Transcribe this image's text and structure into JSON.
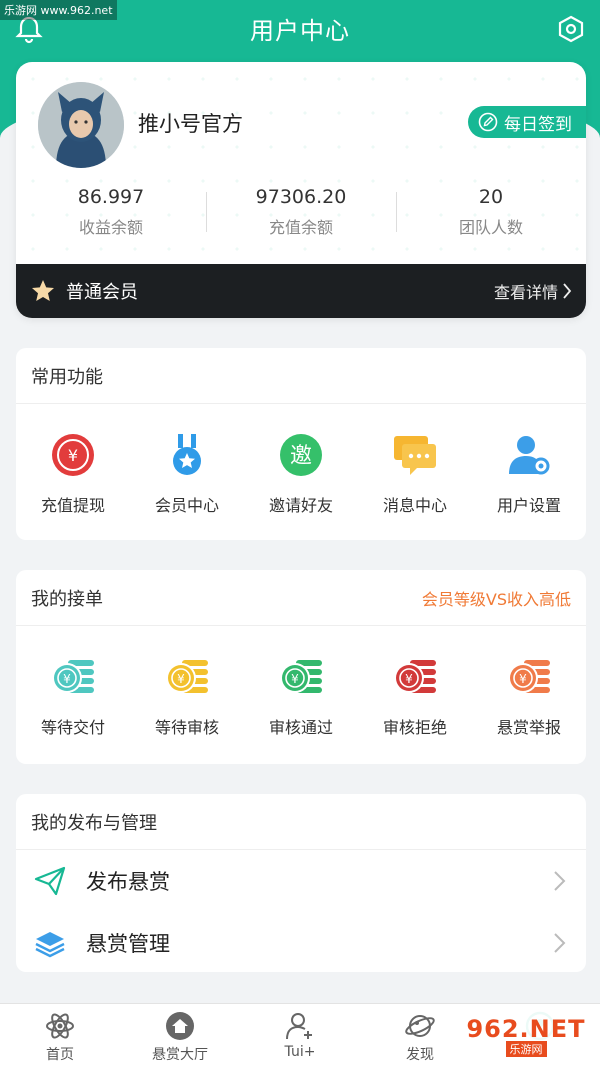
{
  "watermark": "乐游网 www.962.net",
  "header": {
    "title": "用户中心",
    "bell_icon": "bell-icon",
    "settings_icon": "hexagon-gear-icon",
    "accent": "#17b894"
  },
  "profile": {
    "username": "推小号官方",
    "checkin_label": "每日签到",
    "stats": [
      {
        "value": "86.997",
        "label": "收益余额"
      },
      {
        "value": "97306.20",
        "label": "充值余额"
      },
      {
        "value": "20",
        "label": "团队人数"
      }
    ],
    "member_level": "普通会员",
    "member_more": "查看详情"
  },
  "common": {
    "title": "常用功能",
    "items": [
      {
        "label": "充值提现",
        "icon": "yuan-circle-icon",
        "color": "#e23c3c"
      },
      {
        "label": "会员中心",
        "icon": "medal-icon",
        "color": "#2f9be8"
      },
      {
        "label": "邀请好友",
        "icon": "invite-icon",
        "color": "#35c06a",
        "glyph": "邀"
      },
      {
        "label": "消息中心",
        "icon": "chat-bubbles-icon",
        "color": "#f6b631"
      },
      {
        "label": "用户设置",
        "icon": "user-gear-icon",
        "color": "#3c9ee8"
      }
    ]
  },
  "orders": {
    "title": "我的接单",
    "extra": "会员等级VS收入高低",
    "items": [
      {
        "label": "等待交付",
        "icon": "coins-icon",
        "color": "#4fc7c0"
      },
      {
        "label": "等待审核",
        "icon": "coins-icon",
        "color": "#f3c12e"
      },
      {
        "label": "审核通过",
        "icon": "coins-icon",
        "color": "#33b86d"
      },
      {
        "label": "审核拒绝",
        "icon": "coins-icon",
        "color": "#d23a3a"
      },
      {
        "label": "悬赏举报",
        "icon": "coins-icon",
        "color": "#f07b4a"
      }
    ]
  },
  "publish": {
    "title": "我的发布与管理",
    "rows": [
      {
        "label": "发布悬赏",
        "icon": "paper-plane-icon"
      },
      {
        "label": "悬赏管理",
        "icon": "layers-icon"
      }
    ]
  },
  "tabbar": [
    {
      "label": "首页",
      "icon": "atom-icon"
    },
    {
      "label": "悬赏大厅",
      "icon": "home-icon"
    },
    {
      "label": "Tui+",
      "icon": "user-plus-icon"
    },
    {
      "label": "发现",
      "icon": "planet-icon"
    },
    {
      "label": "",
      "icon": "profile-icon"
    }
  ],
  "site_badge": {
    "big": "962.NET",
    "small": "乐游网"
  }
}
